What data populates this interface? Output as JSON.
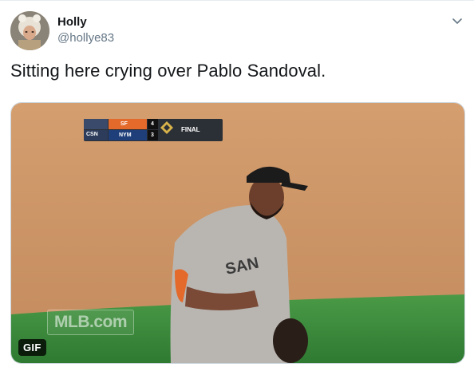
{
  "tweet": {
    "author_name": "Holly",
    "author_handle": "@hollye83",
    "text": "Sitting here crying over Pablo Sandoval.",
    "menu_icon": "chevron-down-icon"
  },
  "media": {
    "badge": "GIF",
    "watermark": "MLB.com",
    "scorebug": {
      "network_top": "",
      "network_bottom": "CSN",
      "team1": "SF",
      "score1": "4",
      "team2": "NYM",
      "score2": "3",
      "status": "FINAL"
    }
  },
  "colors": {
    "text": "#14171a",
    "secondary": "#657786",
    "border": "#ccd6dd",
    "dirt": "#c9956a",
    "grass": "#3c8d3b"
  }
}
